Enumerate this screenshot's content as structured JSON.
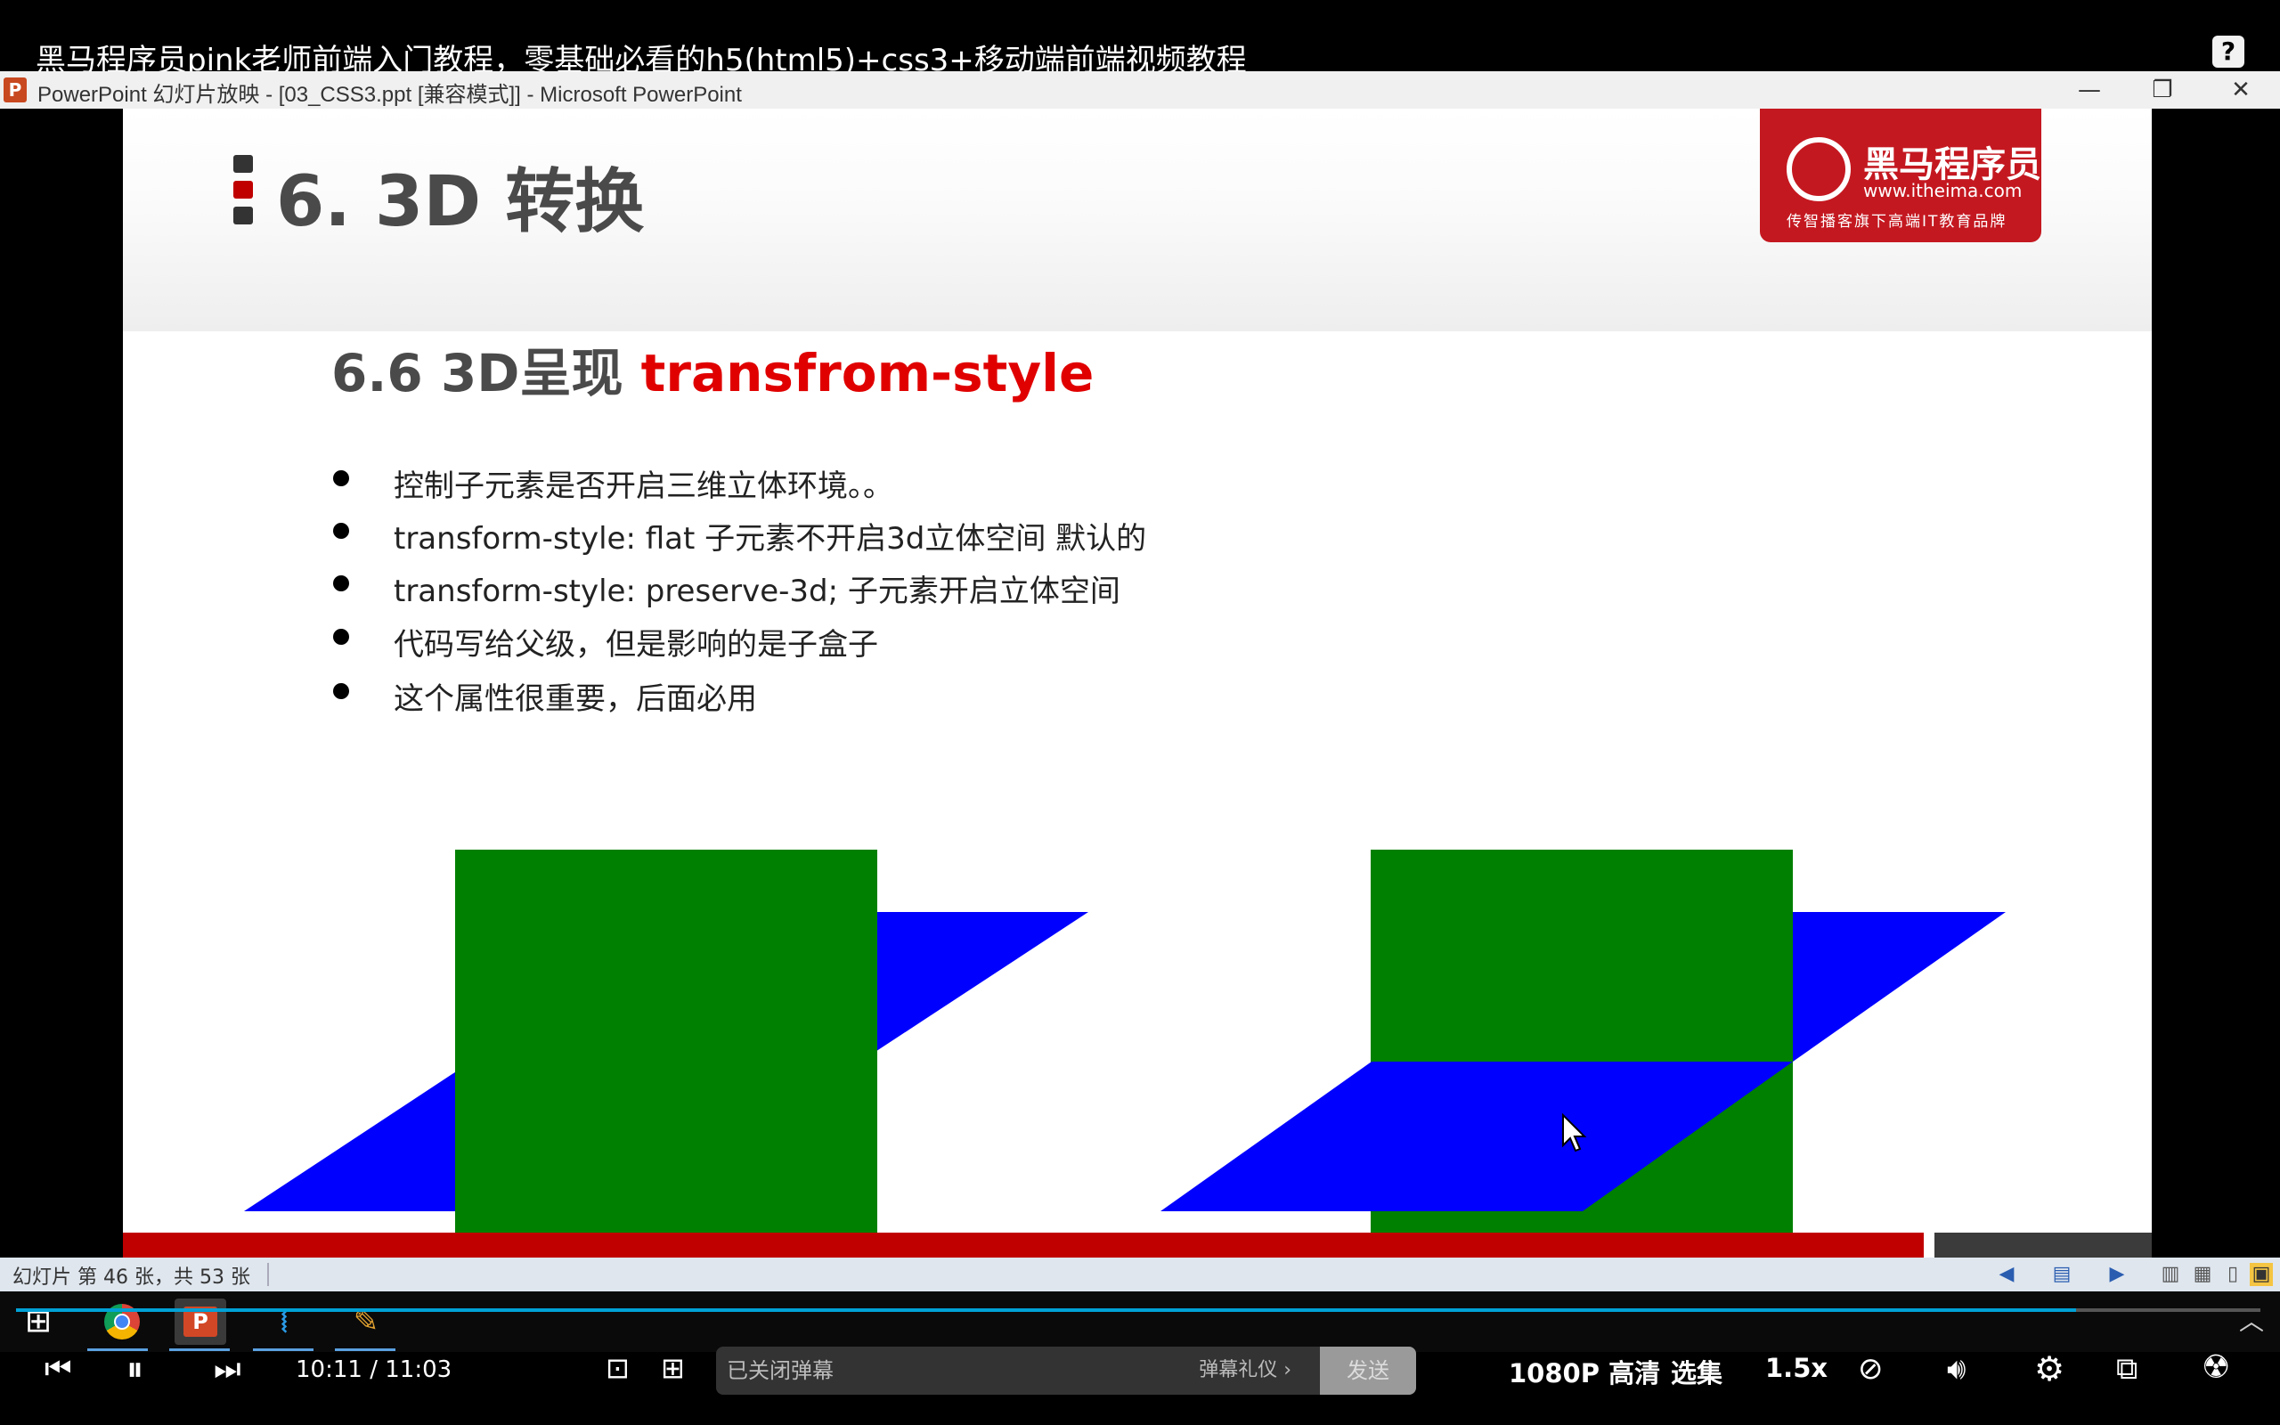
{
  "video": {
    "title": "黑马程序员pink老师前端入门教程，零基础必看的h5(html5)+css3+移动端前端视频教程",
    "help": "?"
  },
  "ppt_window": {
    "app_icon": "P",
    "title": "PowerPoint 幻灯片放映 - [03_CSS3.ppt [兼容模式]] - Microsoft PowerPoint"
  },
  "slide": {
    "section_title": "6. 3D 转换",
    "heading_prefix": "6.6 3D呈现 ",
    "heading_highlight": "transfrom-style",
    "bullets": [
      "控制子元素是否开启三维立体环境。。",
      "transform-style: flat 子元素不开启3d立体空间  默认的",
      "transform-style: preserve-3d; 子元素开启立体空间",
      "代码写给父级，但是影响的是子盒子",
      "这个属性很重要，后面必用"
    ],
    "logo": {
      "name": "黑马程序员",
      "url": "www.itheima.com",
      "slogan": "传智播客旗下高端IT教育品牌"
    },
    "colors": {
      "accent_red": "#e00000",
      "box_green": "#008000",
      "plane_blue": "#0000ff"
    }
  },
  "statusbar": {
    "slide_counter": "幻灯片 第 46 张，共 53 张"
  },
  "taskbar": {
    "apps": [
      "windows-start",
      "chrome",
      "powerpoint",
      "vscode",
      "other-app"
    ]
  },
  "player": {
    "progress_fraction": 0.918,
    "current_time": "10:11",
    "total_time": "11:03",
    "danmaku_placeholder": "已关闭弹幕",
    "danmaku_gift": "弹幕礼仪 ›",
    "send_label": "发送",
    "quality": "1080P 高清",
    "episodes": "选集",
    "speed": "1.5x"
  }
}
